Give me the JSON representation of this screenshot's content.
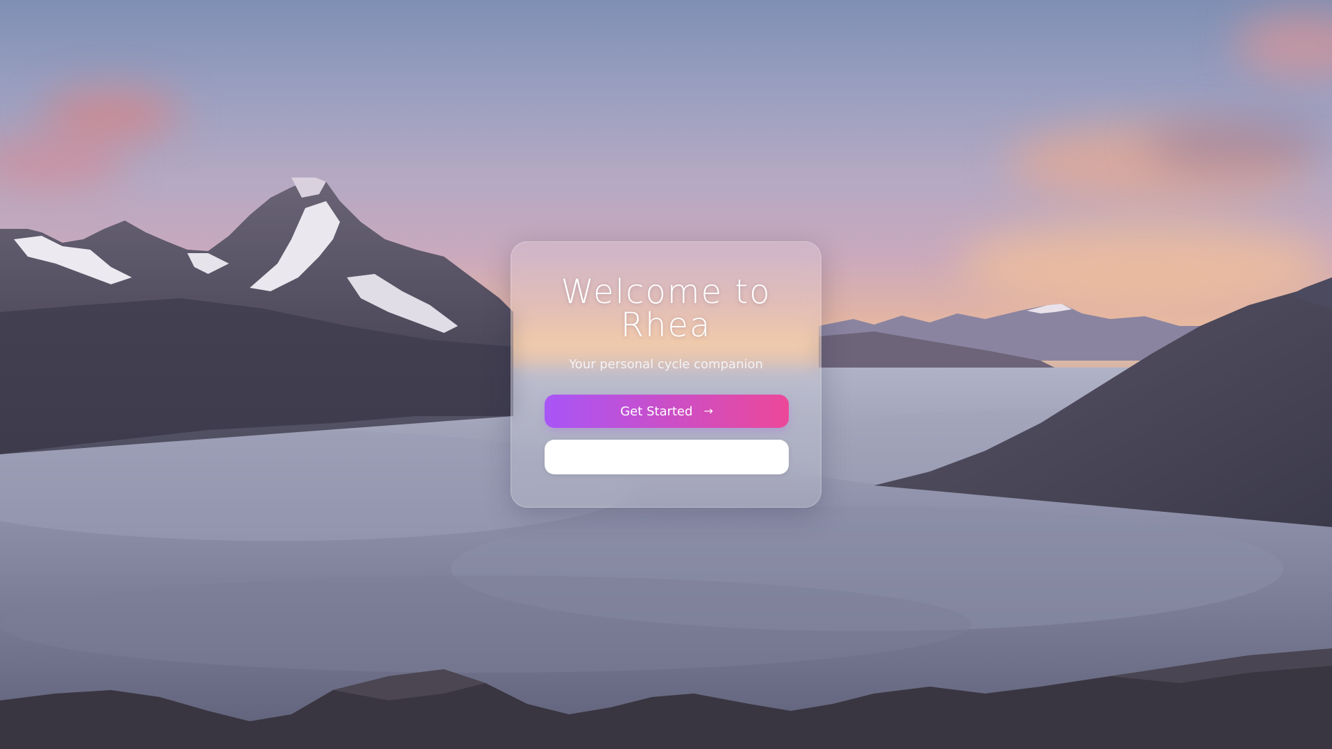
{
  "page": {
    "title_line": "Welcome to Rhea",
    "subtitle": "Your personal cycle companion"
  },
  "actions": {
    "primary_label": "Get Started",
    "primary_icon": "arrow-right-icon",
    "secondary_label": ""
  },
  "colors": {
    "primary_gradient_start": "#a855f7",
    "primary_gradient_end": "#ec4899",
    "secondary_bg": "#ffffff"
  }
}
